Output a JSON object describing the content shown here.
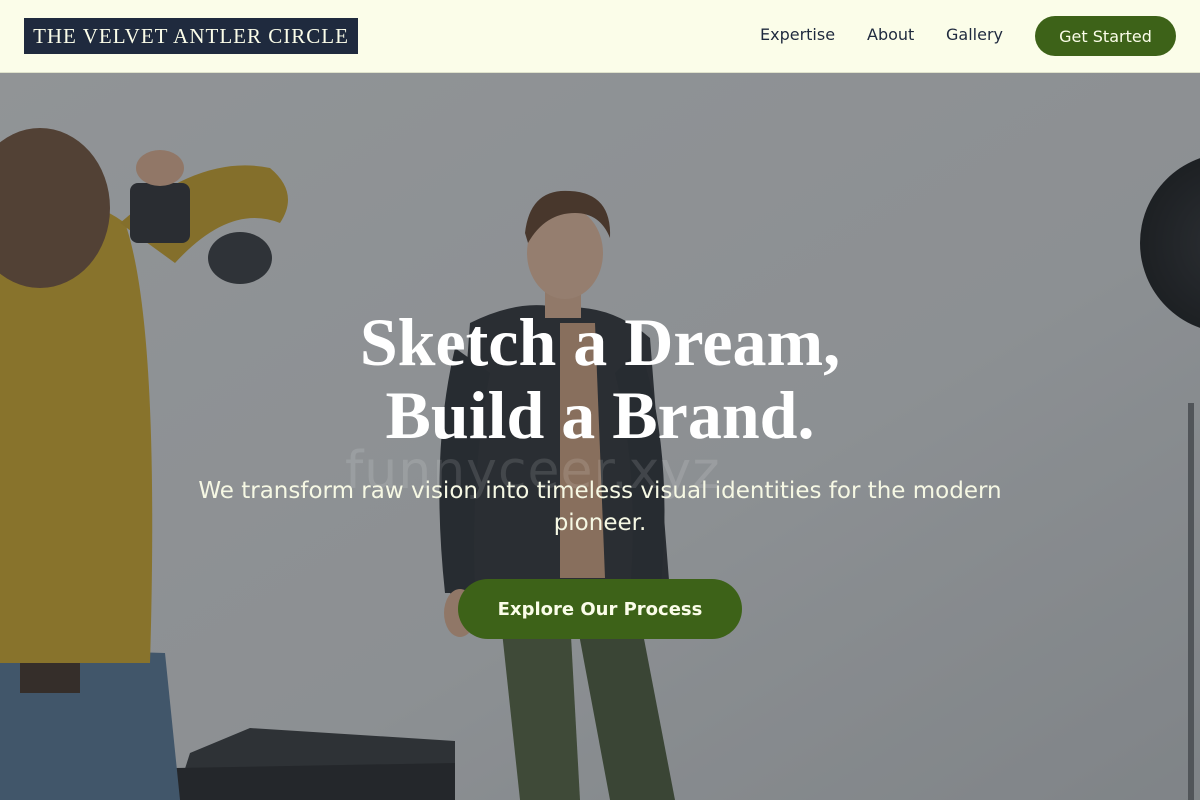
{
  "header": {
    "logo": "THE VELVET ANTLER CIRCLE",
    "nav": [
      "Expertise",
      "About",
      "Gallery"
    ],
    "cta_label": "Get Started"
  },
  "hero": {
    "title_line1": "Sketch a Dream,",
    "title_line2": "Build a Brand.",
    "subtitle": "We transform raw vision into timeless visual identities for the modern pioneer.",
    "cta_label": "Explore Our Process",
    "watermark": "funnyceer.xyz",
    "image": "photo shoot scene: photographer in mustard sweater shooting a male model in dark jacket in a grey studio"
  },
  "colors": {
    "header_bg": "#fbfde9",
    "logo_bg": "#1f2a3e",
    "accent_green": "#3d6218",
    "text_dark": "#1f2a3e"
  }
}
